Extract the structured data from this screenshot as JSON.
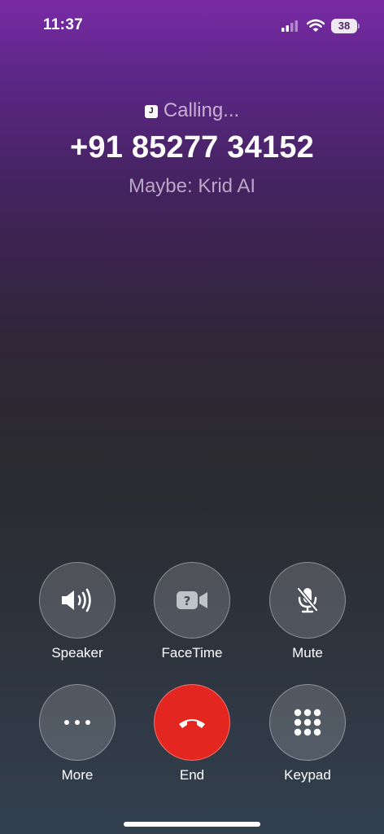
{
  "status_bar": {
    "time": "11:37",
    "battery_level": "38",
    "icons": [
      "cellular-signal-icon",
      "wifi-icon",
      "battery-icon"
    ]
  },
  "call": {
    "app_badge": "J",
    "status": "Calling...",
    "number": "+91 85277 34152",
    "caller_hint": "Maybe: Krid AI"
  },
  "controls": {
    "speaker": {
      "label": "Speaker",
      "icon": "speaker-icon"
    },
    "facetime": {
      "label": "FaceTime",
      "icon": "facetime-camera-icon"
    },
    "mute": {
      "label": "Mute",
      "icon": "mute-mic-icon"
    },
    "more": {
      "label": "More",
      "icon": "ellipsis-icon"
    },
    "end": {
      "label": "End",
      "icon": "end-call-icon",
      "color": "#e3261f"
    },
    "keypad": {
      "label": "Keypad",
      "icon": "keypad-icon"
    }
  }
}
